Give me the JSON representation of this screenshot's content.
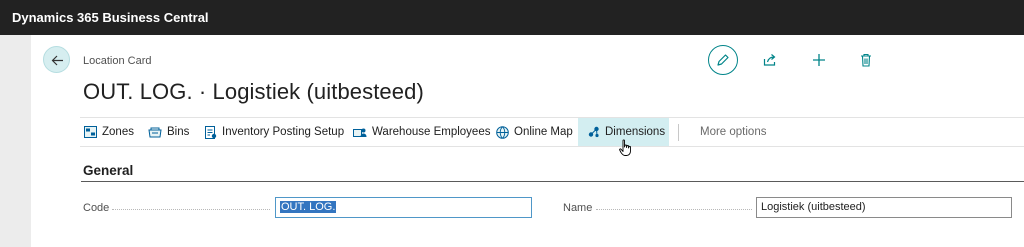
{
  "app": {
    "title": "Dynamics 365 Business Central"
  },
  "page": {
    "breadcrumb": "Location Card",
    "title": "OUT. LOG. · Logistiek (uitbesteed)"
  },
  "top_actions": {
    "edit": "pencil-icon",
    "share": "share-icon",
    "new": "plus-icon",
    "delete": "trash-icon"
  },
  "action_bar": {
    "items": [
      {
        "label": "Zones",
        "icon": "zones-icon"
      },
      {
        "label": "Bins",
        "icon": "bins-icon"
      },
      {
        "label": "Inventory Posting Setup",
        "icon": "setup-icon"
      },
      {
        "label": "Warehouse Employees",
        "icon": "employees-icon"
      },
      {
        "label": "Online Map",
        "icon": "globe-icon"
      },
      {
        "label": "Dimensions",
        "icon": "dimensions-icon",
        "active": true
      }
    ],
    "more": "More options"
  },
  "general": {
    "title": "General",
    "code": {
      "label": "Code",
      "value": "OUT. LOG."
    },
    "name": {
      "label": "Name",
      "value": "Logistiek (uitbesteed)"
    }
  },
  "colors": {
    "accent": "#008489",
    "topbar": "#222222",
    "active_tab": "#d3eef1",
    "selection": "#3375c0"
  }
}
